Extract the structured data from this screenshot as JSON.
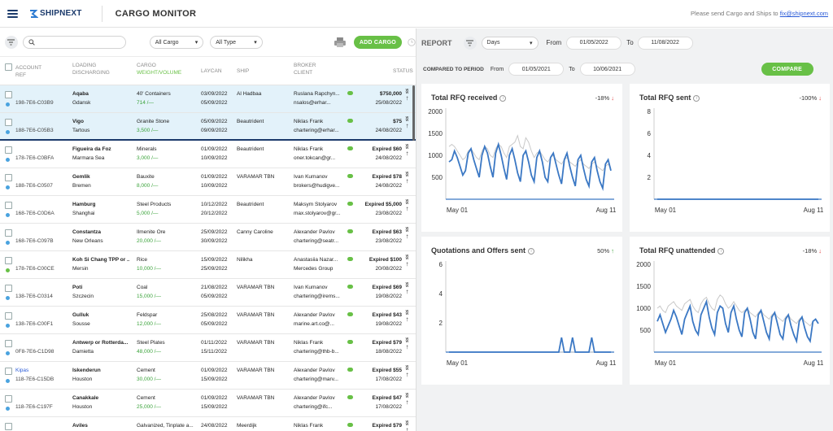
{
  "header": {
    "logo": "SHIPNEXT",
    "title": "CARGO MONITOR",
    "contact_prefix": "Please send Cargo and Ships to",
    "contact_email": "fix@shipnext.com"
  },
  "filters": {
    "search_placeholder": "",
    "cargo_select": "All Cargo",
    "type_select": "All Type",
    "add_cargo": "ADD CARGO"
  },
  "columns": {
    "account": "ACCOUNT",
    "ref": "REF",
    "loading": "LOADING",
    "discharging": "DISCHARGING",
    "cargo": "CARGO",
    "weight": "WEIGHT/VOLUME",
    "laycan": "LAYCAN",
    "ship": "SHIP",
    "broker": "BROKER",
    "client": "CLIENT",
    "status": "STATUS"
  },
  "rows": [
    {
      "ref": "198-7E6-C03B9",
      "account": "",
      "load": "Aqaba",
      "disch": "Gdansk",
      "cargo": "40' Containers",
      "weight": "714 /—",
      "lay1": "03/09/2022",
      "lay2": "05/09/2022",
      "ship": "Al Hadbaa",
      "broker": "Ruslana Rapchyn...",
      "client": "nsalos@erhar...",
      "s1": "$750,000",
      "s2": "25/08/2022",
      "dot": "blue"
    },
    {
      "ref": "188-7E6-C05B3",
      "account": "",
      "load": "Vigo",
      "disch": "Tartous",
      "cargo": "Granite Stone",
      "weight": "3,500 /—",
      "lay1": "05/09/2022",
      "lay2": "09/09/2022",
      "ship": "Beautrident",
      "broker": "Niklas Frank",
      "client": "chartering@erhar...",
      "s1": "$75",
      "s2": "24/08/2022",
      "dot": "blue"
    },
    {
      "ref": "178-7E6-C0BFA",
      "account": "",
      "load": "Figueira da Foz",
      "disch": "Marmara Sea",
      "cargo": "Minerals",
      "weight": "3,000 /—",
      "lay1": "01/09/2022",
      "lay2": "10/09/2022",
      "ship": "Beautrident",
      "broker": "Niklas Frank",
      "client": "oner.tokcan@gr...",
      "s1": "Expired $60",
      "s2": "24/08/2022",
      "dot": "blue"
    },
    {
      "ref": "188-7E6-C0507",
      "account": "",
      "load": "Gemlik",
      "disch": "Bremen",
      "cargo": "Bauxite",
      "weight": "8,000 /—",
      "lay1": "01/09/2022",
      "lay2": "10/09/2022",
      "ship": "VARAMAR TBN",
      "broker": "Ivan Kumanov",
      "client": "brokers@hudigve...",
      "s1": "Expired $78",
      "s2": "24/08/2022",
      "dot": "blue"
    },
    {
      "ref": "168-7E6-C0D6A",
      "account": "",
      "load": "Hamburg",
      "disch": "Shanghai",
      "cargo": "Steel Products",
      "weight": "5,000 /—",
      "lay1": "10/12/2022",
      "lay2": "20/12/2022",
      "ship": "Beautrident",
      "broker": "Maksym Stolyarov",
      "client": "max.stolyarov@gr...",
      "s1": "Expired $5,000",
      "s2": "23/08/2022",
      "dot": "blue"
    },
    {
      "ref": "168-7E6-C097B",
      "account": "",
      "load": "Constantza",
      "disch": "New Orleans",
      "cargo": "Ilmenite Ore",
      "weight": "20,000 /—",
      "lay1": "25/09/2022",
      "lay2": "30/09/2022",
      "ship": "Canny Caroline",
      "broker": "Alexander Pavlov",
      "client": "chartering@seatr...",
      "s1": "Expired $63",
      "s2": "23/08/2022",
      "dot": "blue"
    },
    {
      "ref": "178-7E6-C00CE",
      "account": "",
      "load": "Koh Si Chang TPP or ...",
      "disch": "Mersin",
      "cargo": "Rice",
      "weight": "10,000 /—",
      "lay1": "15/09/2022",
      "lay2": "25/09/2022",
      "ship": "Nilikha",
      "broker": "Anastasiia Nazar...",
      "client": "Mercedes Group",
      "s1": "Expired $100",
      "s2": "20/08/2022",
      "dot": "green"
    },
    {
      "ref": "138-7E6-C0314",
      "account": "",
      "load": "Poti",
      "disch": "Szczecin",
      "cargo": "Coal",
      "weight": "15,000 /—",
      "lay1": "21/08/2022",
      "lay2": "05/09/2022",
      "ship": "VARAMAR TBN",
      "broker": "Ivan Kumanov",
      "client": "chartering@irems...",
      "s1": "Expired $69",
      "s2": "19/08/2022",
      "dot": "blue"
    },
    {
      "ref": "138-7E6-C00F1",
      "account": "",
      "load": "Gulluk",
      "disch": "Sousse",
      "cargo": "Feldspar",
      "weight": "12,000 /—",
      "lay1": "25/08/2022",
      "lay2": "05/09/2022",
      "ship": "VARAMAR TBN",
      "broker": "Alexander Pavlov",
      "client": "marine.art.co@...",
      "s1": "Expired $43",
      "s2": "19/08/2022",
      "dot": "blue"
    },
    {
      "ref": "0F8-7E6-C1D98",
      "account": "",
      "load": "Antwerp or Rotterda...",
      "disch": "Damietta",
      "cargo": "Steel Plates",
      "weight": "48,000 /—",
      "lay1": "01/11/2022",
      "lay2": "15/11/2022",
      "ship": "VARAMAR TBN",
      "broker": "Niklas Frank",
      "client": "chartering@thb-b...",
      "s1": "Expired $79",
      "s2": "18/08/2022",
      "dot": "blue"
    },
    {
      "ref": "118-7E6-C15DB",
      "account": "Kipas",
      "load": "Iskenderun",
      "disch": "Houston",
      "cargo": "Cement",
      "weight": "30,000 /—",
      "lay1": "01/09/2022",
      "lay2": "15/09/2022",
      "ship": "VARAMAR TBN",
      "broker": "Alexander Pavlov",
      "client": "chartering@marv...",
      "s1": "Expired $55",
      "s2": "17/08/2022",
      "dot": "blue"
    },
    {
      "ref": "118-7E6-C197F",
      "account": "",
      "load": "Canakkale",
      "disch": "Houston",
      "cargo": "Cement",
      "weight": "25,000 /—",
      "lay1": "01/09/2022",
      "lay2": "15/09/2022",
      "ship": "VARAMAR TBN",
      "broker": "Alexander Pavlov",
      "client": "chartering@ifc...",
      "s1": "Expired $47",
      "s2": "17/08/2022",
      "dot": "blue"
    },
    {
      "ref": "",
      "account": "",
      "load": "Aviles",
      "disch": "",
      "cargo": "Galvanized, Tinplate a...",
      "weight": "",
      "lay1": "24/08/2022",
      "lay2": "",
      "ship": "Meerdijk",
      "broker": "Niklas Frank",
      "client": "",
      "s1": "Expired $79",
      "s2": "",
      "dot": "blue"
    }
  ],
  "report": {
    "title": "REPORT",
    "period": "Days",
    "from_label": "From",
    "to_label": "To",
    "from": "01/05/2022",
    "to": "11/08/2022",
    "compare_label": "COMPARED TO PERIOD",
    "c_from": "01/05/2021",
    "c_to": "10/06/2021",
    "compare_btn": "COMPARE"
  },
  "chart_data": [
    {
      "type": "line",
      "title": "Total RFQ received",
      "change": "-18%",
      "trend": "down",
      "x_labels": [
        "May 01",
        "Aug 11"
      ],
      "y_ticks": [
        500,
        1000,
        1500,
        2000
      ],
      "ylim": [
        0,
        2000
      ],
      "series": [
        {
          "values": [
            850,
            900,
            1100,
            950,
            750,
            550,
            650,
            1050,
            1150,
            900,
            700,
            500,
            1000,
            1200,
            1050,
            750,
            500,
            1050,
            1250,
            1000,
            700,
            450,
            1000,
            1150,
            900,
            600,
            400,
            1000,
            1100,
            850,
            550,
            400,
            950,
            1100,
            850,
            500,
            400,
            950,
            1050,
            800,
            550,
            350,
            900,
            1050,
            750,
            500,
            300,
            900,
            1000,
            700,
            450,
            300,
            850,
            950,
            650,
            400,
            250,
            800,
            900,
            650
          ]
        },
        {
          "values": [
            1200,
            1250,
            1200,
            1100,
            1000,
            900,
            950,
            1100,
            1150,
            1050,
            950,
            900,
            1100,
            1200,
            1150,
            1000,
            950,
            1150,
            1250,
            1200,
            1050,
            950,
            1200,
            1250,
            1300,
            1450,
            1200,
            1150,
            1400,
            1300,
            1100,
            950,
            1050,
            1100,
            1000,
            900,
            850,
            950,
            1000,
            900,
            850,
            800,
            900,
            950,
            850,
            800,
            750,
            850,
            900,
            800,
            750,
            700,
            800,
            850,
            750,
            700,
            650,
            750,
            800,
            700
          ]
        }
      ]
    },
    {
      "type": "line",
      "title": "Total RFQ sent",
      "change": "-100%",
      "trend": "down",
      "x_labels": [
        "May 01",
        "Aug 11"
      ],
      "y_ticks": [
        2,
        4,
        6,
        8
      ],
      "ylim": [
        0,
        8
      ],
      "series": [
        {
          "values": [
            0,
            0,
            0,
            0,
            0,
            0,
            0,
            0,
            0,
            0,
            0,
            0,
            0,
            0,
            0,
            0,
            0,
            0,
            0,
            0,
            0,
            0,
            0,
            0,
            0,
            0,
            0,
            0,
            0,
            0,
            0,
            0,
            0,
            0,
            0,
            0,
            0,
            0,
            0,
            0,
            0,
            0,
            0,
            0,
            0,
            0,
            0,
            0,
            0,
            0,
            0,
            0,
            0,
            0,
            0,
            0,
            0,
            0,
            0,
            0
          ]
        },
        {
          "values": [
            0,
            0,
            0,
            0,
            0,
            0,
            0,
            0,
            0,
            0,
            0,
            0,
            0,
            0,
            0,
            0,
            0,
            0,
            0,
            0,
            0,
            0,
            0,
            0,
            0,
            0,
            0,
            0,
            0,
            0,
            0,
            0,
            0,
            0,
            0,
            0,
            0,
            0,
            0,
            0,
            0,
            0,
            0,
            0,
            0,
            0,
            0,
            0,
            0,
            0,
            0,
            0,
            0,
            0,
            0,
            0,
            0,
            0,
            0,
            0
          ]
        }
      ]
    },
    {
      "type": "line",
      "title": "Quotations and Offers sent",
      "change": "50%",
      "trend": "up",
      "x_labels": [
        "May 01",
        "Aug 11"
      ],
      "y_ticks": [
        2,
        4,
        6
      ],
      "ylim": [
        0,
        6
      ],
      "series": [
        {
          "values": [
            0,
            0,
            0,
            0,
            0,
            0,
            0,
            0,
            0,
            0,
            0,
            0,
            0,
            0,
            0,
            0,
            0,
            0,
            0,
            0,
            0,
            0,
            0,
            0,
            0,
            0,
            0,
            0,
            0,
            0,
            0,
            0,
            0,
            0,
            0,
            0,
            0,
            0,
            0,
            0,
            0,
            1,
            0,
            0,
            0,
            1,
            0,
            0,
            0,
            0,
            0,
            0,
            1,
            0,
            0,
            0,
            0,
            0,
            0,
            0
          ]
        },
        {
          "values": [
            0,
            0,
            0,
            0,
            0,
            0,
            0,
            0,
            0,
            0,
            0,
            0,
            0,
            0,
            0,
            0,
            0,
            0,
            0,
            0,
            0,
            0,
            0,
            0,
            0,
            0,
            0,
            0,
            0,
            0,
            0,
            0,
            0,
            0,
            0,
            0,
            0,
            0,
            0,
            0,
            0,
            0,
            0,
            0,
            0,
            0,
            0,
            0,
            0,
            0,
            0,
            0,
            0,
            0,
            0,
            0,
            0,
            0,
            0,
            0
          ]
        }
      ]
    },
    {
      "type": "line",
      "title": "Total RFQ unattended",
      "change": "-18%",
      "trend": "down",
      "x_labels": [
        "May 01",
        "Aug 11"
      ],
      "y_ticks": [
        500,
        1000,
        1500,
        2000
      ],
      "ylim": [
        0,
        2000
      ],
      "series": [
        {
          "values": [
            700,
            850,
            650,
            450,
            600,
            750,
            950,
            800,
            600,
            400,
            750,
            900,
            1050,
            700,
            500,
            400,
            850,
            1000,
            1150,
            800,
            550,
            400,
            900,
            1050,
            1000,
            650,
            450,
            900,
            1050,
            750,
            500,
            350,
            900,
            1000,
            750,
            450,
            300,
            850,
            950,
            700,
            450,
            300,
            800,
            900,
            650,
            400,
            300,
            750,
            850,
            600,
            400,
            250,
            700,
            800,
            550,
            350,
            250,
            700,
            750,
            650
          ]
        },
        {
          "values": [
            1000,
            1050,
            950,
            900,
            1050,
            1100,
            1150,
            1050,
            1000,
            950,
            1100,
            1150,
            1200,
            1050,
            950,
            900,
            1100,
            1200,
            1250,
            1100,
            1000,
            950,
            1200,
            1300,
            1250,
            1100,
            1000,
            1050,
            1150,
            1050,
            950,
            900,
            950,
            1000,
            900,
            850,
            800,
            900,
            950,
            850,
            800,
            750,
            850,
            900,
            800,
            750,
            700,
            800,
            850,
            750,
            700,
            650,
            750,
            800,
            700,
            650,
            600,
            700,
            750,
            650
          ]
        }
      ]
    }
  ],
  "colors": {
    "accent_green": "#68c046",
    "brand_navy": "#1b3a6b",
    "series_primary": "#3b78c4",
    "series_compare": "#c9c9c9"
  }
}
